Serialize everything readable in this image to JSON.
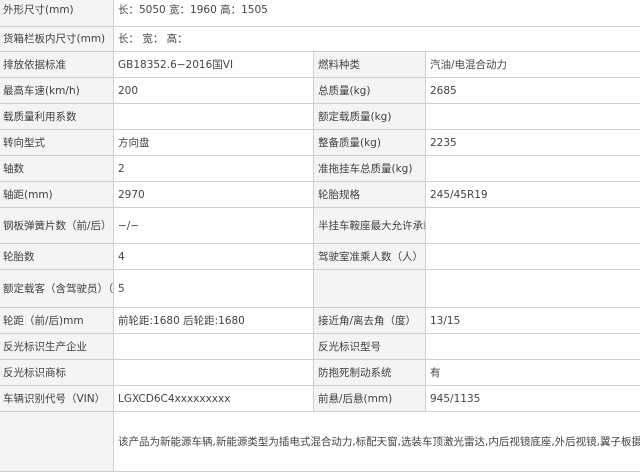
{
  "rows": [
    {
      "k1": "外形尺寸(mm)",
      "v1": "长：5050 宽：1960 高：1505",
      "k2": "",
      "v2": "",
      "span": true
    },
    {
      "k1": "货箱栏板内尺寸(mm)",
      "v1": "长：  宽：  高：",
      "k2": "",
      "v2": "",
      "span": true
    },
    {
      "k1": "排放依据标准",
      "v1": "GB18352.6−2016国VI",
      "k2": "燃料种类",
      "v2": "汽油/电混合动力"
    },
    {
      "k1": "最高车速(km/h)",
      "v1": "200",
      "k2": "总质量(kg)",
      "v2": "2685"
    },
    {
      "k1": "载质量利用系数",
      "v1": "",
      "k2": "额定载质量(kg)",
      "v2": ""
    },
    {
      "k1": "转向型式",
      "v1": "方向盘",
      "k2": "整备质量(kg)",
      "v2": "2235"
    },
    {
      "k1": "轴数",
      "v1": "2",
      "k2": "准拖挂车总质量(kg)",
      "v2": ""
    },
    {
      "k1": "轴距(mm)",
      "v1": "2970",
      "k2": "轮胎规格",
      "v2": "245/45R19"
    },
    {
      "k1": "钢板弹簧片数（前/后）",
      "v1": "−/−",
      "k2": "半挂车鞍座最大允许承载质量(kg)",
      "v2": ""
    },
    {
      "k1": "轮胎数",
      "v1": "4",
      "k2": "驾驶室准乘人数（人）",
      "v2": ""
    },
    {
      "k1": "额定载客（含驾驶员）（座位数）",
      "v1": "5",
      "k2": "",
      "v2": ""
    },
    {
      "k1": "轮距（前/后)mm",
      "v1": "前轮距:1680 后轮距:1680",
      "k2": "接近角/离去角（度）",
      "v2": "13/15"
    },
    {
      "k1": "反光标识生产企业",
      "v1": "",
      "k2": "反光标识型号",
      "v2": ""
    },
    {
      "k1": "反光标识商标",
      "v1": "",
      "k2": "防抱死制动系统",
      "v2": "有"
    },
    {
      "k1": "车辆识别代号（VIN）",
      "v1": "LGXCD6C4xxxxxxxxx",
      "k2": "前悬/后悬(mm)",
      "v2": "945/1135"
    }
  ],
  "note": "该产品为新能源车辆,新能源类型为插电式混合动力,标配天窗,选装车顶激光雷达,内后视镜底座,外后视镜,翼子板摄像头,车身侧面不同颜色装饰件,黑色套件,轮辋,前摄像头,鲨鱼鳍装饰件,字标.储能装置种类:磷酸铁锂蓄电池,储能装置单体生产企业:广西东盟弗迪电池有限公司,储能装置总成生产企业:广西东盟弗迪电池有限公司.驱动电机类型:前:永磁同步电机/后:永磁同步电"
}
